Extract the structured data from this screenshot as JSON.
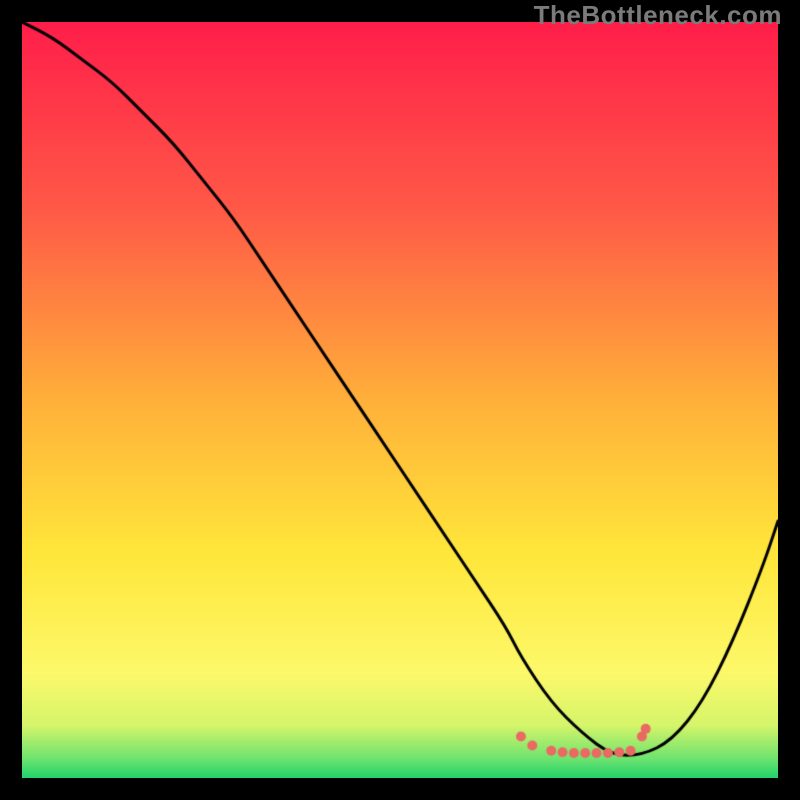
{
  "watermark": "TheBottleneck.com",
  "chart_data": {
    "type": "line",
    "title": "",
    "xlabel": "",
    "ylabel": "",
    "xlim": [
      0,
      100
    ],
    "ylim": [
      0,
      100
    ],
    "grid": false,
    "legend": false,
    "background_gradient": {
      "stops": [
        {
          "pct": 0.0,
          "color": "#ff1e4a"
        },
        {
          "pct": 0.25,
          "color": "#ff5a47"
        },
        {
          "pct": 0.5,
          "color": "#ffb03a"
        },
        {
          "pct": 0.7,
          "color": "#ffe63a"
        },
        {
          "pct": 0.86,
          "color": "#fdf96a"
        },
        {
          "pct": 0.93,
          "color": "#d6f56a"
        },
        {
          "pct": 0.975,
          "color": "#6de36f"
        },
        {
          "pct": 1.0,
          "color": "#21d36c"
        }
      ]
    },
    "series": [
      {
        "name": "bottleneck-curve",
        "color": "#000000",
        "width": 3,
        "x": [
          0,
          4,
          8,
          12,
          16,
          20,
          24,
          28,
          32,
          36,
          40,
          44,
          48,
          52,
          56,
          60,
          64,
          66,
          70,
          74,
          78,
          82,
          86,
          90,
          94,
          98,
          100
        ],
        "y": [
          100,
          98,
          95,
          92,
          88,
          84,
          79,
          74,
          68,
          62,
          56,
          50,
          44,
          38,
          32,
          26,
          20,
          16,
          10,
          6,
          3,
          3,
          5,
          10,
          18,
          28,
          34
        ]
      }
    ],
    "markers": {
      "name": "optimal-markers",
      "color": "#ea6a63",
      "radius": 5,
      "points": [
        {
          "x": 66,
          "y": 5.5
        },
        {
          "x": 67.5,
          "y": 4.3
        },
        {
          "x": 70,
          "y": 3.6
        },
        {
          "x": 71.5,
          "y": 3.4
        },
        {
          "x": 73,
          "y": 3.3
        },
        {
          "x": 74.5,
          "y": 3.3
        },
        {
          "x": 76,
          "y": 3.3
        },
        {
          "x": 77.5,
          "y": 3.3
        },
        {
          "x": 79,
          "y": 3.4
        },
        {
          "x": 80.5,
          "y": 3.6
        },
        {
          "x": 82,
          "y": 5.5
        },
        {
          "x": 82.5,
          "y": 6.5
        }
      ]
    }
  }
}
